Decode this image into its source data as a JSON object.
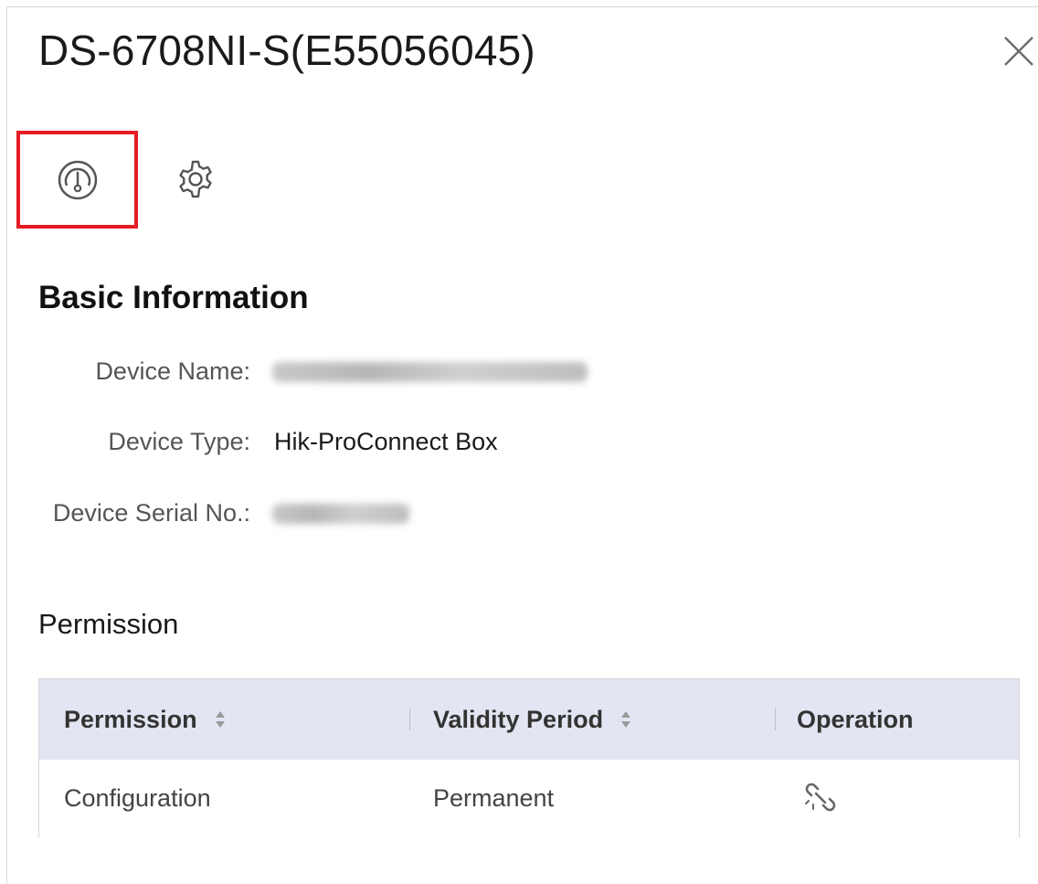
{
  "dialog": {
    "title": "DS-6708NI-S(E55056045)",
    "close_icon": "close-icon"
  },
  "toolbar": {
    "items": [
      {
        "icon": "device-status-gauge-icon",
        "highlighted": true,
        "highlight_color": "#e51c23"
      },
      {
        "icon": "gear-icon",
        "highlighted": false
      }
    ]
  },
  "basic_info": {
    "heading": "Basic Information",
    "fields": [
      {
        "label": "Device Name:",
        "value": "",
        "blurred": true
      },
      {
        "label": "Device Type:",
        "value": "Hik-ProConnect Box",
        "blurred": false
      },
      {
        "label": "Device Serial No.:",
        "value": "",
        "blurred": true
      }
    ]
  },
  "permission": {
    "heading": "Permission",
    "columns": [
      {
        "label": "Permission",
        "sortable": true
      },
      {
        "label": "Validity Period",
        "sortable": true
      },
      {
        "label": "Operation",
        "sortable": false
      }
    ],
    "rows": [
      {
        "permission": "Configuration",
        "validity": "Permanent",
        "operation_icon": "unlink-icon"
      }
    ],
    "header_bg": "#e3e6f2"
  }
}
